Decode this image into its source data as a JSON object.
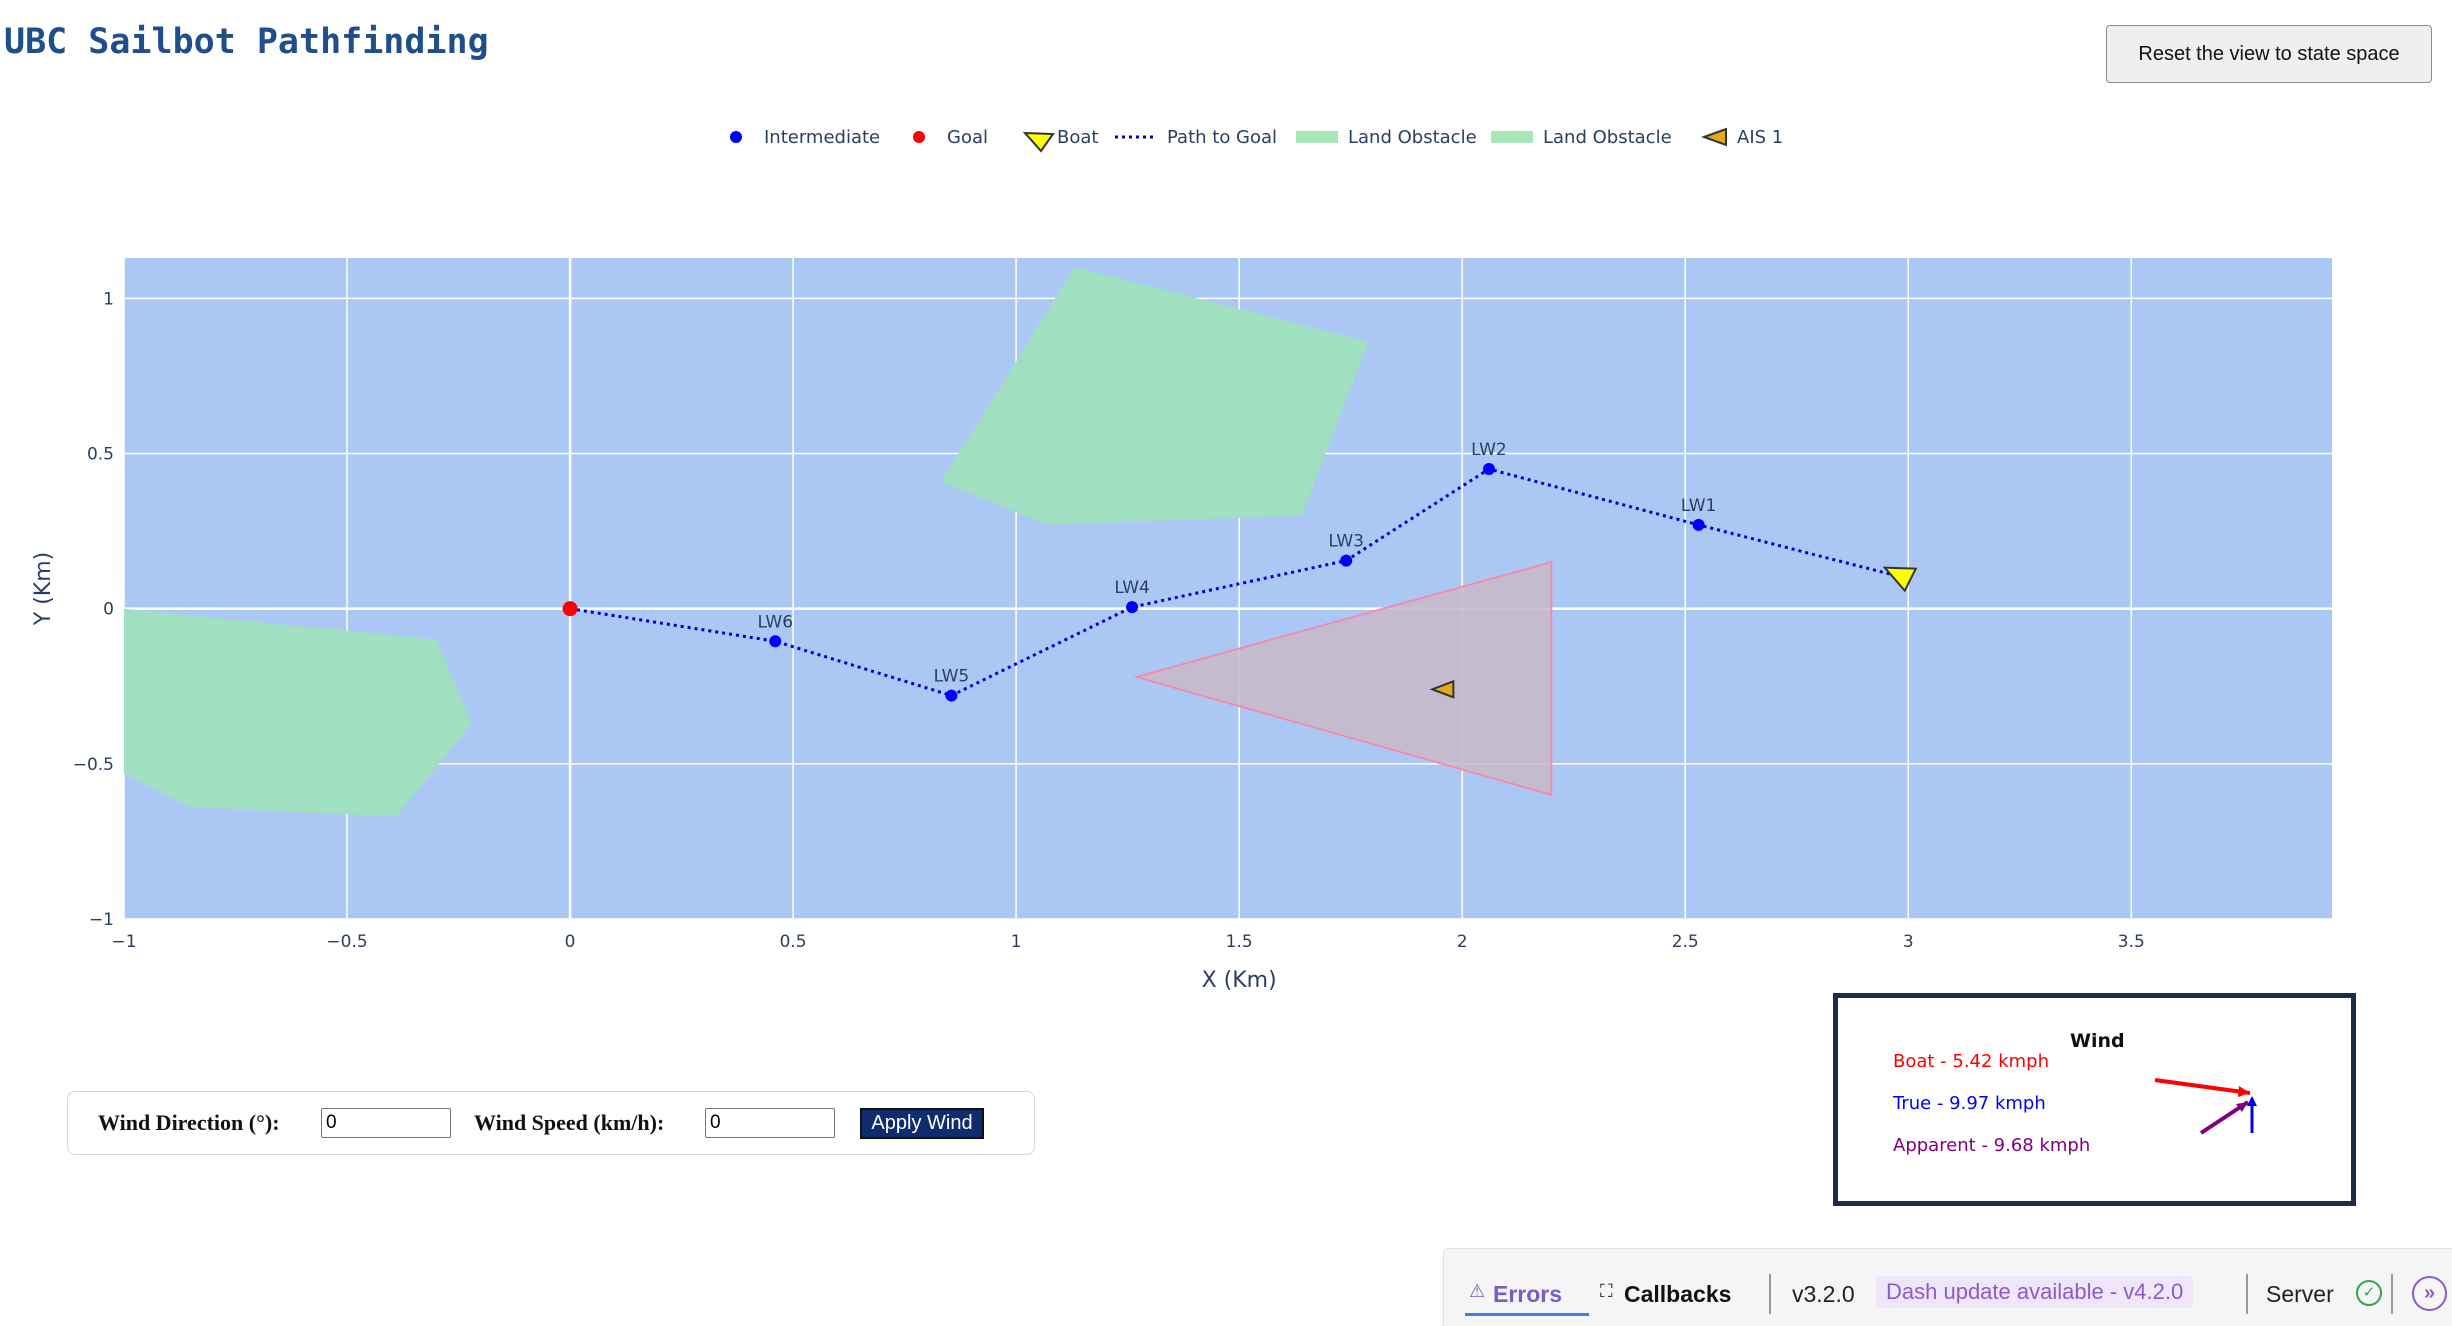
{
  "app": {
    "title": "UBC Sailbot Pathfinding"
  },
  "toolbar": {
    "reset_label": "Reset the view to state space"
  },
  "legend": [
    {
      "label": "Intermediate",
      "symbol": "dot",
      "color": "#0000ff"
    },
    {
      "label": "Goal",
      "symbol": "dot",
      "color": "#ff0000"
    },
    {
      "label": "Boat",
      "symbol": "triangle",
      "color": "#ffff00"
    },
    {
      "label": "Path to Goal",
      "symbol": "dotted-line",
      "color": "#0000cc"
    },
    {
      "label": "Land Obstacle",
      "symbol": "fill",
      "color": "#a8e6b8"
    },
    {
      "label": "Land Obstacle",
      "symbol": "fill",
      "color": "#a8e6b8"
    },
    {
      "label": "AIS 1",
      "symbol": "triangle",
      "color": "#e6a817"
    }
  ],
  "chart_data": {
    "type": "scatter",
    "xlabel": "X (Km)",
    "ylabel": "Y (Km)",
    "xlim": [
      -1,
      3.95
    ],
    "ylim": [
      -1,
      1.13
    ],
    "xticks": [
      -1,
      -0.5,
      0,
      0.5,
      1,
      1.5,
      2,
      2.5,
      3,
      3.5
    ],
    "xtick_labels": [
      "−1",
      "−0.5",
      "0",
      "0.5",
      "1",
      "1.5",
      "2",
      "2.5",
      "3",
      "3.5"
    ],
    "yticks": [
      -1,
      -0.5,
      0,
      0.5,
      1
    ],
    "ytick_labels": [
      "−1",
      "−0.5",
      "0",
      "0.5",
      "1"
    ],
    "plot_bg": "#abc8f5",
    "grid": true,
    "goal": {
      "x": 0,
      "y": 0,
      "color": "#ff0000"
    },
    "intermediate": [
      {
        "name": "LW6",
        "x": 0.46,
        "y": -0.105
      },
      {
        "name": "LW5",
        "x": 0.855,
        "y": -0.28
      },
      {
        "name": "LW4",
        "x": 1.26,
        "y": 0.005
      },
      {
        "name": "LW3",
        "x": 1.74,
        "y": 0.155
      },
      {
        "name": "LW2",
        "x": 2.06,
        "y": 0.45
      },
      {
        "name": "LW1",
        "x": 2.53,
        "y": 0.27
      }
    ],
    "path_to_goal": [
      [
        0,
        0
      ],
      [
        0.46,
        -0.105
      ],
      [
        0.855,
        -0.28
      ],
      [
        1.26,
        0.005
      ],
      [
        1.74,
        0.155
      ],
      [
        2.06,
        0.45
      ],
      [
        2.53,
        0.27
      ],
      [
        2.99,
        0.1
      ]
    ],
    "boat": {
      "x": 2.99,
      "y": 0.1,
      "heading_deg": 200,
      "color": "#ffff00"
    },
    "ais": [
      {
        "name": "AIS 1",
        "x": 1.96,
        "y": -0.26,
        "heading_deg": 180,
        "color": "#e6a817"
      }
    ],
    "land_obstacles": [
      {
        "name": "Land Obstacle",
        "color": "#a0e0c0",
        "points": [
          [
            1.13,
            1.1
          ],
          [
            1.79,
            0.86
          ],
          [
            1.64,
            0.3
          ],
          [
            1.07,
            0.27
          ],
          [
            0.83,
            0.41
          ],
          [
            0.92,
            0.61
          ]
        ]
      },
      {
        "name": "Land Obstacle",
        "color": "#a0e0c0",
        "points": [
          [
            -1,
            0.0
          ],
          [
            -0.3,
            -0.1
          ],
          [
            -0.22,
            -0.37
          ],
          [
            -0.39,
            -0.67
          ],
          [
            -0.85,
            -0.64
          ],
          [
            -1,
            -0.53
          ]
        ]
      }
    ],
    "ais_zone": {
      "points": [
        [
          1.27,
          -0.22
        ],
        [
          2.2,
          0.15
        ],
        [
          2.2,
          -0.6
        ]
      ],
      "stroke": "#f08cb4",
      "fill": "#c9b9c7"
    }
  },
  "wind_controls": {
    "direction_label": "Wind Direction (°):",
    "direction_value": "0",
    "speed_label": "Wind Speed (km/h):",
    "speed_value": "0",
    "apply_label": "Apply Wind"
  },
  "wind_panel": {
    "title": "Wind",
    "boat": {
      "label": "Boat - 5.42 kmph",
      "color": "#ff0000"
    },
    "true": {
      "label": "True - 9.97 kmph",
      "color": "#0000ff"
    },
    "apparent": {
      "label": "Apparent - 9.68 kmph",
      "color": "#800080"
    }
  },
  "dash_bar": {
    "errors_label": "Errors",
    "callbacks_label": "Callbacks",
    "version": "v3.2.0",
    "update_label": "Dash update available - v4.2.0",
    "server_label": "Server"
  }
}
